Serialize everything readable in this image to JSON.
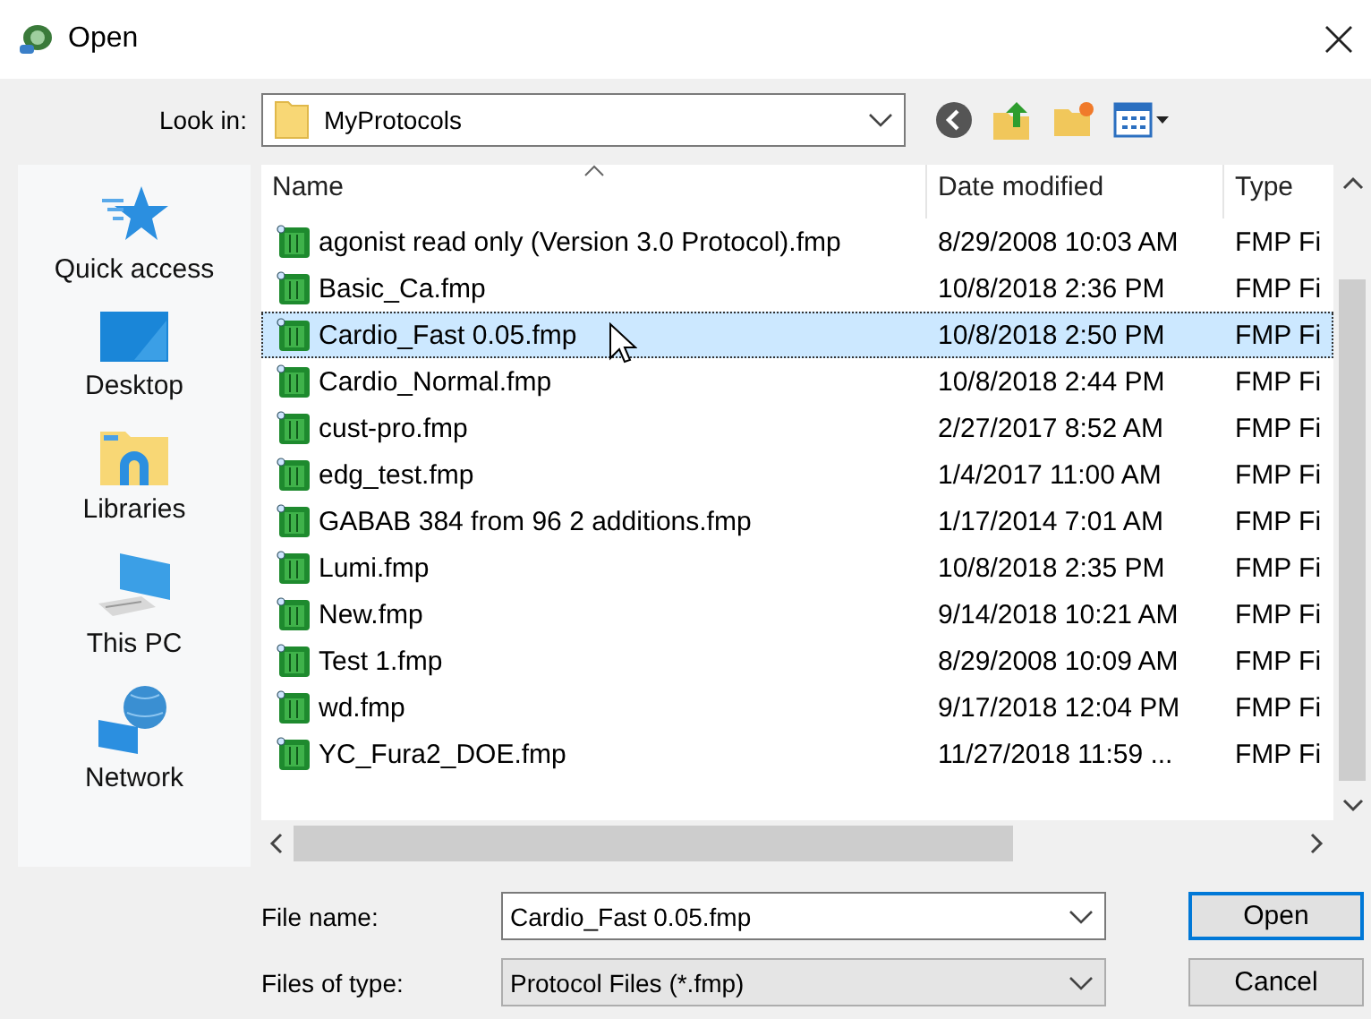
{
  "window": {
    "title": "Open"
  },
  "look_in": {
    "label": "Look in:",
    "value": "MyProtocols"
  },
  "sidebar": {
    "items": [
      {
        "label": "Quick access",
        "kind": "star"
      },
      {
        "label": "Desktop",
        "kind": "desktop"
      },
      {
        "label": "Libraries",
        "kind": "libraries"
      },
      {
        "label": "This PC",
        "kind": "pc"
      },
      {
        "label": "Network",
        "kind": "network"
      }
    ]
  },
  "table": {
    "columns": [
      "Name",
      "Date modified",
      "Type"
    ],
    "rows": [
      {
        "name": "agonist read only (Version 3.0 Protocol).fmp",
        "date": "8/29/2008 10:03 AM",
        "type": "FMP Fi",
        "selected": false
      },
      {
        "name": "Basic_Ca.fmp",
        "date": "10/8/2018 2:36 PM",
        "type": "FMP Fi",
        "selected": false
      },
      {
        "name": "Cardio_Fast 0.05.fmp",
        "date": "10/8/2018 2:50 PM",
        "type": "FMP Fi",
        "selected": true
      },
      {
        "name": "Cardio_Normal.fmp",
        "date": "10/8/2018 2:44 PM",
        "type": "FMP Fi",
        "selected": false
      },
      {
        "name": "cust-pro.fmp",
        "date": "2/27/2017 8:52 AM",
        "type": "FMP Fi",
        "selected": false
      },
      {
        "name": "edg_test.fmp",
        "date": "1/4/2017 11:00 AM",
        "type": "FMP Fi",
        "selected": false
      },
      {
        "name": "GABAB 384 from 96 2 additions.fmp",
        "date": "1/17/2014 7:01 AM",
        "type": "FMP Fi",
        "selected": false
      },
      {
        "name": "Lumi.fmp",
        "date": "10/8/2018 2:35 PM",
        "type": "FMP Fi",
        "selected": false
      },
      {
        "name": "New.fmp",
        "date": "9/14/2018 10:21 AM",
        "type": "FMP Fi",
        "selected": false
      },
      {
        "name": "Test 1.fmp",
        "date": "8/29/2008 10:09 AM",
        "type": "FMP Fi",
        "selected": false
      },
      {
        "name": "wd.fmp",
        "date": "9/17/2018 12:04 PM",
        "type": "FMP Fi",
        "selected": false
      },
      {
        "name": "YC_Fura2_DOE.fmp",
        "date": "11/27/2018 11:59 ...",
        "type": "FMP Fi",
        "selected": false
      }
    ]
  },
  "file_name": {
    "label": "File name:",
    "value": "Cardio_Fast 0.05.fmp"
  },
  "file_type": {
    "label": "Files of type:",
    "value": "Protocol Files (*.fmp)"
  },
  "buttons": [
    {
      "label": "Open",
      "kind": "default"
    },
    {
      "label": "Cancel",
      "kind": "normal"
    }
  ]
}
